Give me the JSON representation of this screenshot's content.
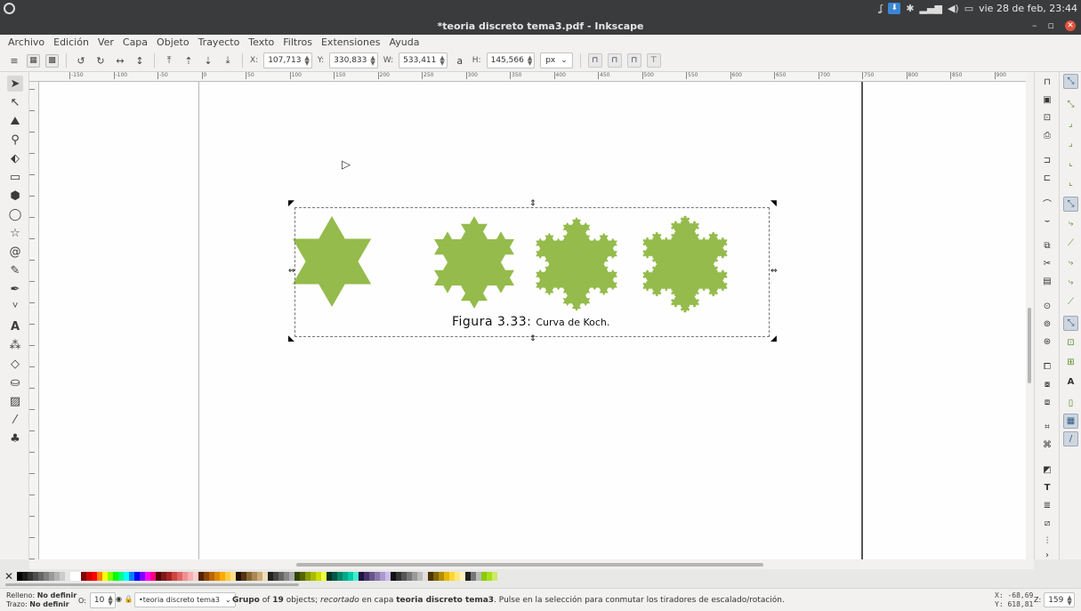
{
  "system": {
    "clock": "vie 28 de feb, 23:44"
  },
  "window": {
    "title": "*teoria discreto tema3.pdf - Inkscape"
  },
  "menu": [
    "Archivo",
    "Edición",
    "Ver",
    "Capa",
    "Objeto",
    "Trayecto",
    "Texto",
    "Filtros",
    "Extensiones",
    "Ayuda"
  ],
  "toolbar": {
    "x_label": "X:",
    "x_value": "107,713",
    "y_label": "Y:",
    "y_value": "330,833",
    "w_label": "W:",
    "w_value": "533,411",
    "h_label": "H:",
    "h_value": "145,566",
    "unit": "px"
  },
  "ruler": {
    "labels": [
      "-150",
      "-100",
      "-50",
      "0",
      "50",
      "100",
      "150",
      "200",
      "250",
      "300",
      "350",
      "400",
      "450",
      "500",
      "550",
      "600",
      "650",
      "700",
      "750",
      "800",
      "850",
      "900"
    ]
  },
  "figure": {
    "caption_label": "Figura 3.33:",
    "caption_text": "Curva de Koch.",
    "fractal_color": "#94bb4b"
  },
  "palette": {
    "none_symbol": "✕"
  },
  "status": {
    "fill_label": "Relleno:",
    "fill_value": "No definir",
    "stroke_label": "Trazo:",
    "stroke_value": "No definir",
    "opacity_label": "O:",
    "opacity_value": "10",
    "layer": "•teoria discreto tema3",
    "msg_group": "Grupo",
    "msg_of": "of",
    "msg_count": "19",
    "msg_objects": "objects;",
    "msg_clipped": "recortado",
    "msg_in_layer": "en capa",
    "msg_layer_name": "teoria discreto tema3",
    "msg_rest": ". Pulse en la selección para conmutar los tiradores de escalado/rotación.",
    "cursor_x": "X:  -68,69",
    "cursor_y": "Y:  618,81",
    "zoom_label": "Z:",
    "zoom_value": "159"
  }
}
